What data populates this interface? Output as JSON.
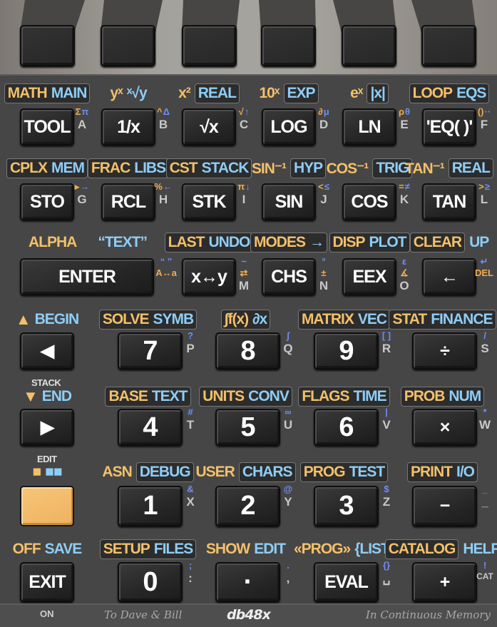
{
  "accent_colors": {
    "shift_left": "#f3c069",
    "shift_right": "#8ecdf6",
    "alpha_symbol": "#6f8ef5",
    "shift_key": "#f0b865"
  },
  "soft_keys": [
    "",
    "",
    "",
    "",
    "",
    ""
  ],
  "keys": [
    {
      "main": "TOOL",
      "f": "MATH",
      "g": "MAIN",
      "sym_f": "Σ",
      "sym_g": "π",
      "letter": "A"
    },
    {
      "main": "1/x",
      "f": "yˣ",
      "g": "ˣ√y",
      "sym_f": "^",
      "sym_g": "Δ",
      "letter": "B"
    },
    {
      "main": "√x",
      "f": "x²",
      "g": "REAL",
      "sym_f": "√",
      "sym_g": "↑",
      "letter": "C"
    },
    {
      "main": "LOG",
      "f": "10ˣ",
      "g": "EXP",
      "sym_f": "∂",
      "sym_g": "μ",
      "letter": "D"
    },
    {
      "main": "LN",
      "f": "eˣ",
      "g": "|x|",
      "sym_f": "ρ",
      "sym_g": "θ",
      "letter": "E"
    },
    {
      "main": "'EQ( )'",
      "f": "LOOP",
      "g": "EQS",
      "sym_f": "()",
      "sym_g": "··",
      "letter": "F"
    },
    {
      "main": "STO",
      "f": "CPLX",
      "g": "MEM",
      "sym_f": "▸",
      "sym_g": "→",
      "letter": "G"
    },
    {
      "main": "RCL",
      "f": "FRAC",
      "g": "LIBS",
      "sym_f": "%",
      "sym_g": "←",
      "letter": "H"
    },
    {
      "main": "STK",
      "f": "CST",
      "g": "STACK",
      "sym_f": "π",
      "sym_g": "↓",
      "letter": "I"
    },
    {
      "main": "SIN",
      "f": "SIN⁻¹",
      "g": "HYP",
      "sym_g": "≤",
      "sym_f": "<",
      "letter": "J"
    },
    {
      "main": "COS",
      "f": "COS⁻¹",
      "g": "TRIG",
      "sym_g": "≠",
      "sym_f": "=",
      "letter": "K"
    },
    {
      "main": "TAN",
      "f": "TAN⁻¹",
      "g": "REAL",
      "sym_g": "≥",
      "sym_f": ">",
      "letter": "L"
    },
    {
      "main": "ENTER",
      "f": "ALPHA",
      "g": "“TEXT”",
      "sym_g": "“ ”",
      "sym_f": "A↔a",
      "letter": ""
    },
    {
      "main": "x↔y",
      "f": "LAST",
      "g": "UNDO",
      "sym_g": "~",
      "sym_f": "⇄",
      "letter": "M"
    },
    {
      "main": "CHS",
      "f": "MODES",
      "g": "→",
      "sym_g": "°",
      "sym_f": "±",
      "letter": "N"
    },
    {
      "main": "EEX",
      "f": "DISP",
      "g": "PLOT",
      "sym_g": "ε",
      "sym_f": "∡",
      "letter": "O"
    },
    {
      "main": "←",
      "f": "CLEAR",
      "g": "UP",
      "sym_g": "↵",
      "sym_f": "DEL",
      "letter": ""
    },
    {
      "main": "◀",
      "f": "▲",
      "g": "BEGIN",
      "letter": ""
    },
    {
      "main": "7",
      "f": "SOLVE",
      "g": "SYMB",
      "sym_g": "?",
      "letter": "P"
    },
    {
      "main": "8",
      "f": "∫f(x)",
      "g": "∂x",
      "sym_g": "∫",
      "letter": "Q"
    },
    {
      "main": "9",
      "f": "MATRIX",
      "g": "VEC",
      "sym_g": "[ ]",
      "letter": "R"
    },
    {
      "main": "÷",
      "f": "STAT",
      "g": "FINANCE",
      "sym_g": "/",
      "letter": "S"
    },
    {
      "main": "▶",
      "f": "▼",
      "g": "END",
      "above": "STACK",
      "letter": ""
    },
    {
      "main": "4",
      "f": "BASE",
      "g": "TEXT",
      "sym_g": "#",
      "letter": "T"
    },
    {
      "main": "5",
      "f": "UNITS",
      "g": "CONV",
      "sym_g": "∞",
      "letter": "U"
    },
    {
      "main": "6",
      "f": "FLAGS",
      "g": "TIME",
      "sym_g": "|",
      "letter": "V"
    },
    {
      "main": "×",
      "f": "PROB",
      "g": "NUM",
      "sym_g": "*",
      "letter": "W"
    },
    {
      "main": "",
      "f": "■",
      "g": "■■",
      "above": "EDIT",
      "letter": ""
    },
    {
      "main": "1",
      "f": "ASN",
      "g": "DEBUG",
      "sym_g": "&",
      "letter": "X"
    },
    {
      "main": "2",
      "f": "USER",
      "g": "CHARS",
      "sym_g": "@",
      "letter": "Y"
    },
    {
      "main": "3",
      "f": "PROG",
      "g": "TEST",
      "sym_g": "$",
      "letter": "Z"
    },
    {
      "main": "−",
      "f": "PRINT",
      "g": "I/O",
      "sym_g": "_",
      "letter": "_"
    },
    {
      "main": "EXIT",
      "f": "OFF",
      "g": "SAVE",
      "below": "ON",
      "letter": ""
    },
    {
      "main": "0",
      "f": "SETUP",
      "g": "FILES",
      "sym_g": ";",
      "letter": ":"
    },
    {
      "main": "·",
      "f": "SHOW",
      "g": "EDIT",
      "sym_g": ".",
      "letter": ","
    },
    {
      "main": "EVAL",
      "f": "«PROG»",
      "g": "{LIST}",
      "sym_g": "{}",
      "letter": "␣"
    },
    {
      "main": "+",
      "f": "CATALOG",
      "g": "HELP",
      "sym_g": "!",
      "letter": "CAT"
    }
  ],
  "footer": {
    "dedication": "To Dave & Bill",
    "logo": "db48x",
    "motto": "In Continuous Memory"
  }
}
